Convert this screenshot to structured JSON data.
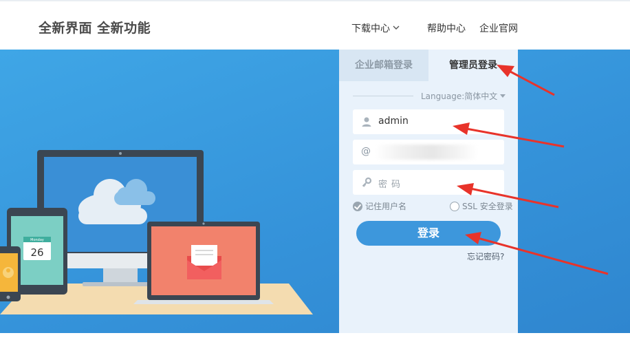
{
  "header": {
    "brand": "全新界面 全新功能",
    "nav": {
      "download": "下载中心",
      "help": "帮助中心",
      "site": "企业官网"
    }
  },
  "illustration": {
    "calendar_month": "Monday",
    "calendar_day": "26"
  },
  "login": {
    "tabs": {
      "email": "企业邮箱登录",
      "admin": "管理员登录"
    },
    "language_label": "Language:简体中文",
    "username_value": "admin",
    "domain_prefix": "@",
    "password_placeholder": "密码",
    "remember_label": "记住用户名",
    "ssl_label": "SSL 安全登录",
    "submit_label": "登录",
    "forgot_label": "忘记密码?"
  },
  "colors": {
    "hero_blue": "#3593da",
    "panel_bg": "#e9f2fb",
    "button_blue": "#3d97dc",
    "annotation_red": "#e8332a"
  }
}
